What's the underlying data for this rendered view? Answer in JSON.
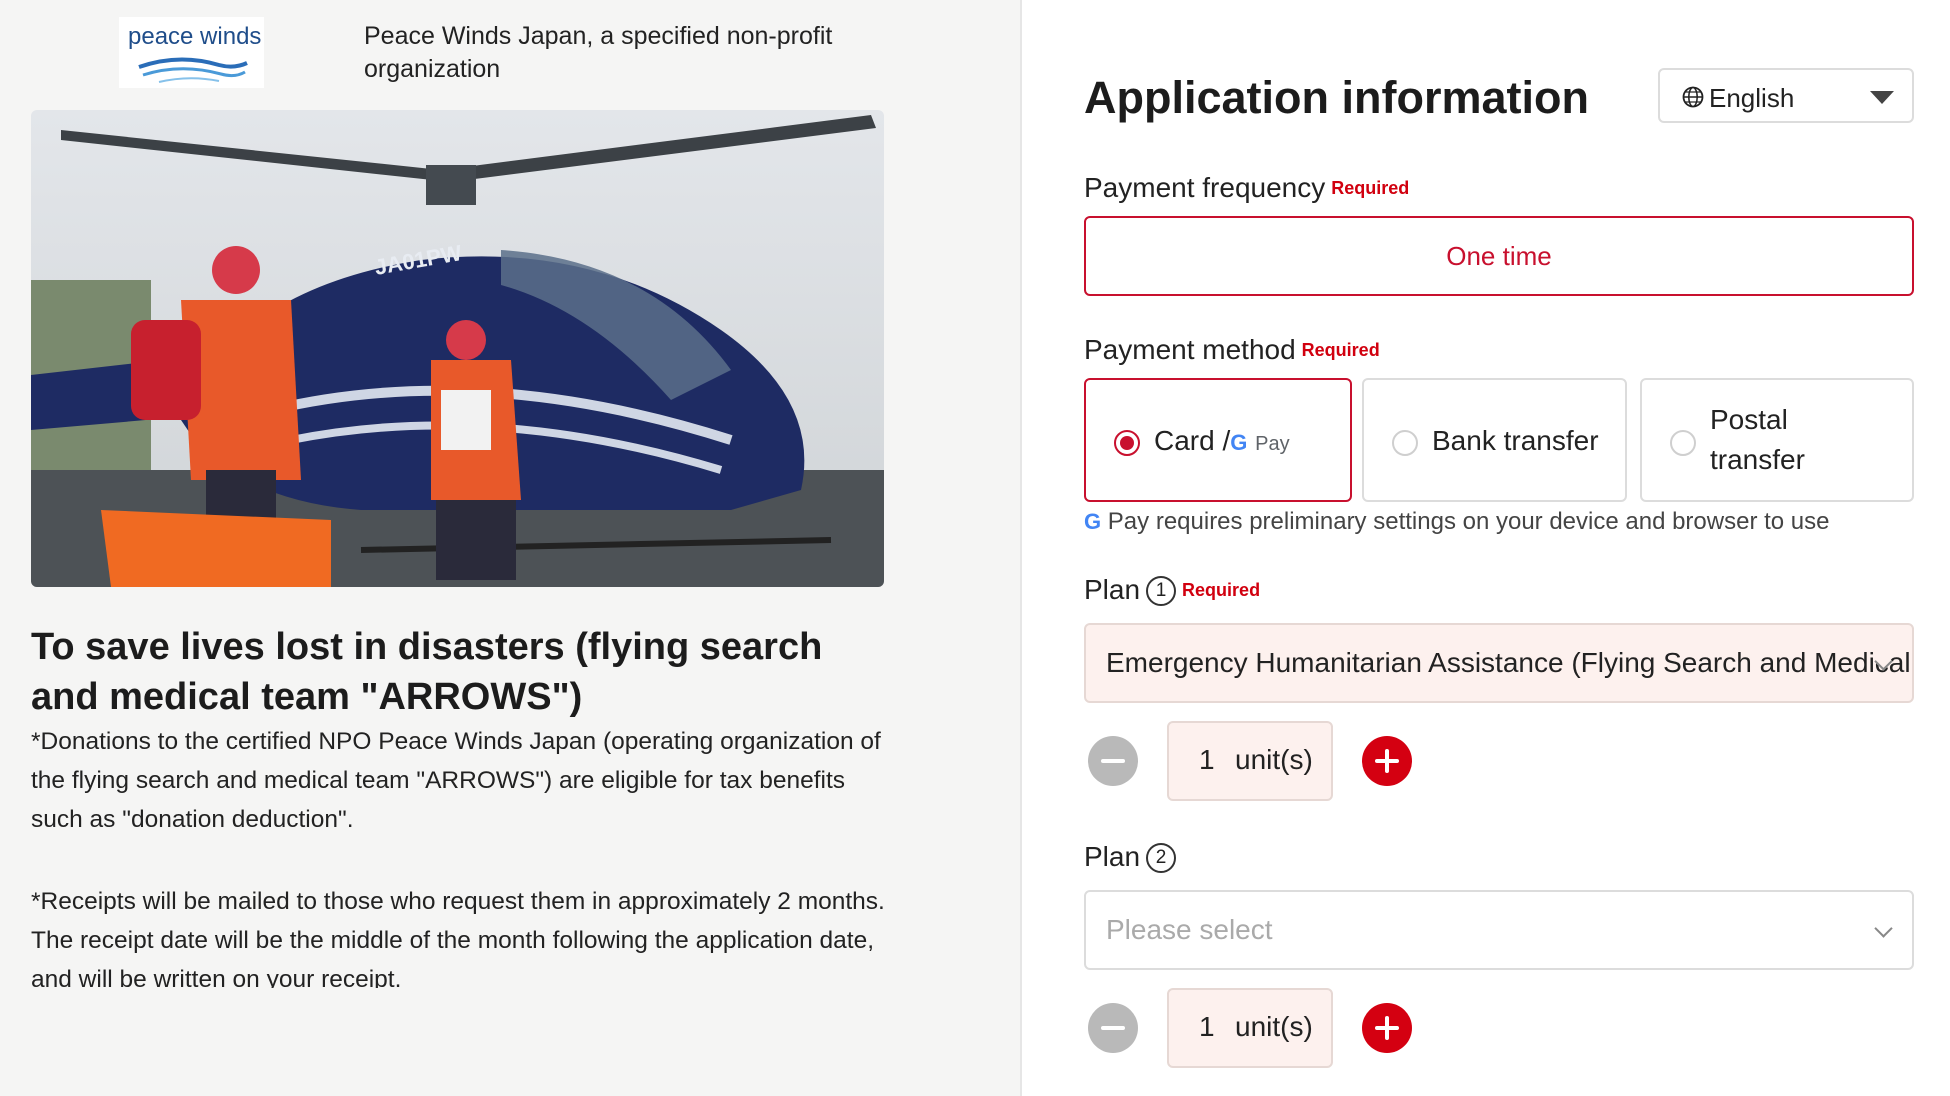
{
  "org": {
    "logo_text": "peace winds",
    "name": "Peace Winds Japan, a specified non-profit organization"
  },
  "campaign": {
    "title": "To save lives lost in disasters (flying search and medical team \"ARROWS\")",
    "helicopter_registration": "JA01PW",
    "description_1": "*Donations to the certified NPO Peace Winds Japan (operating organization of the flying search and medical team \"ARROWS\") are eligible for tax benefits such as \"donation deduction\".",
    "description_2": "*Receipts will be mailed to those who request them in approximately 2 months. The receipt date will be the middle of the month following the application date, and will be written on your receipt."
  },
  "form": {
    "title": "Application information",
    "language": "English",
    "required_label": "Required",
    "payment_frequency": {
      "label": "Payment frequency",
      "value": "One time"
    },
    "payment_method": {
      "label": "Payment method",
      "options": [
        {
          "label": "Card /",
          "gpay": "Pay",
          "selected": true
        },
        {
          "label": "Bank transfer",
          "selected": false
        },
        {
          "label": "Postal transfer",
          "selected": false
        }
      ],
      "gpay_note": "Pay requires preliminary settings on your device and browser to use"
    },
    "plan1": {
      "label": "Plan",
      "number": "1",
      "value": "Emergency Humanitarian Assistance (Flying Search and Medical",
      "quantity": "1",
      "unit": "unit(s)"
    },
    "plan2": {
      "label": "Plan",
      "number": "2",
      "placeholder": "Please select",
      "quantity": "1",
      "unit": "unit(s)"
    }
  },
  "colors": {
    "accent": "#c8102e",
    "plus_button": "#d40011",
    "minus_button": "#b9b9b9",
    "left_panel_bg": "#f5f5f4",
    "filled_field_bg": "#fdf1ee"
  },
  "icons": [
    "globe-icon",
    "caret-down-icon",
    "chevron-down-icon",
    "minus-icon",
    "plus-icon",
    "google-g-icon"
  ]
}
